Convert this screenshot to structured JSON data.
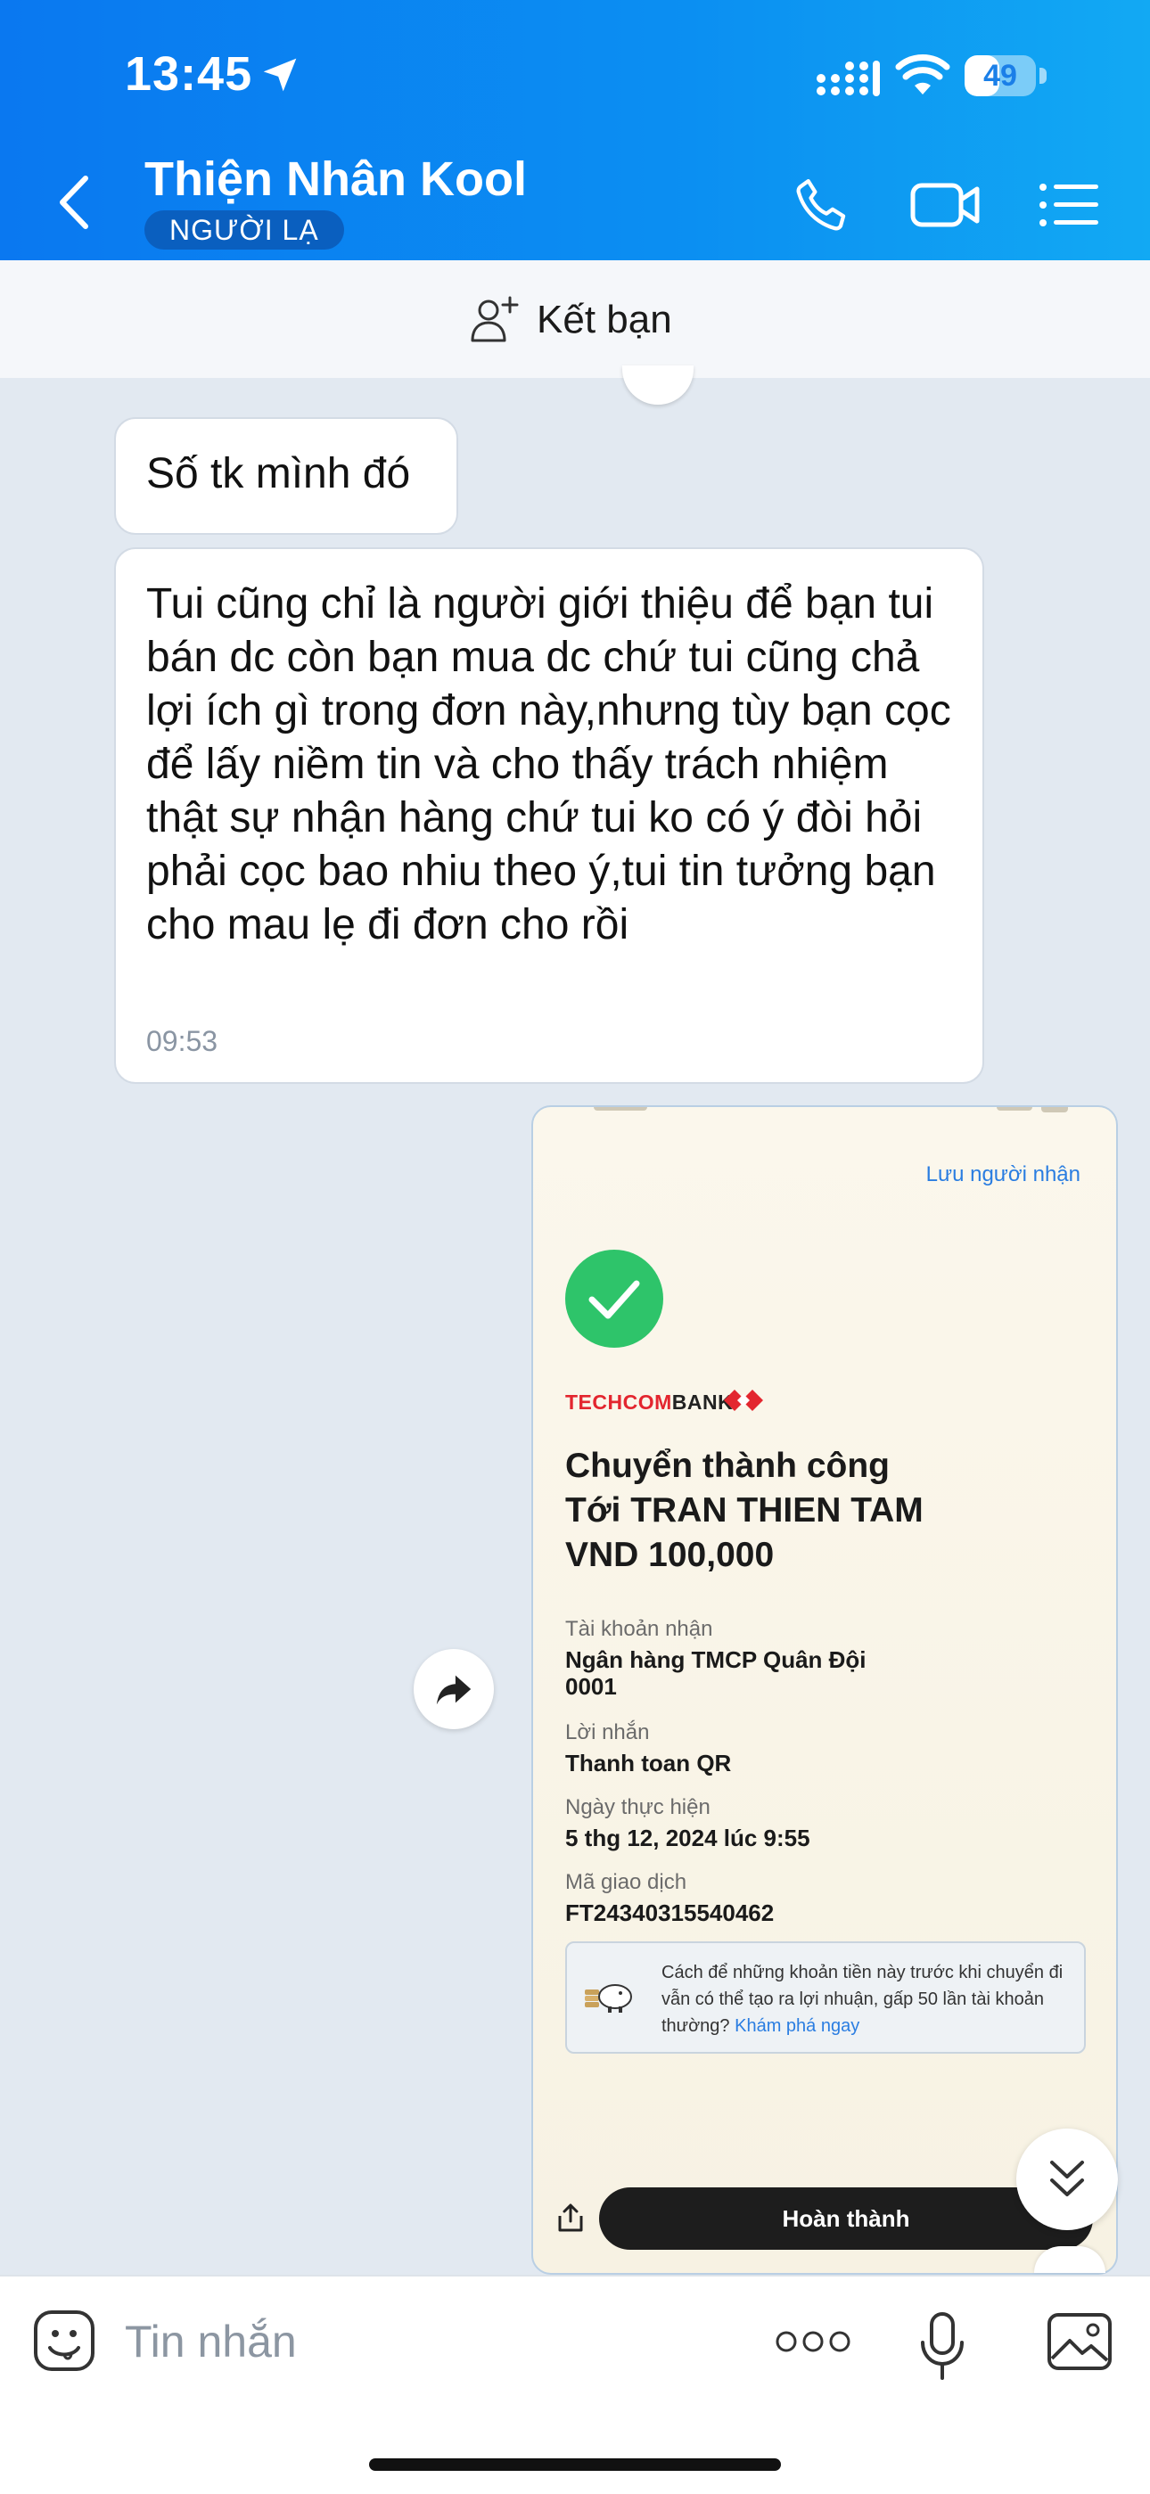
{
  "status_bar": {
    "time": "13:45",
    "battery": "49",
    "battery_level": 0.49
  },
  "header": {
    "contact_name": "Thiện Nhân Kool",
    "badge": "NGƯỜI LẠ"
  },
  "add_friend": {
    "label": "Kết bạn"
  },
  "messages": [
    {
      "text": "Số tk mình đó"
    },
    {
      "text": "Tui cũng chỉ là người giới thiệu để bạn tui bán dc còn bạn mua dc chứ tui cũng chả lợi ích gì trong đơn này,nhưng tùy bạn cọc để lấy niềm tin và cho thấy trách nhiệm thật sự nhận hàng chứ tui ko có ý đòi hỏi phải cọc bao nhiu theo ý,tui tin tưởng bạn cho mau lẹ đi đơn cho rồi",
      "time": "09:53"
    }
  ],
  "receipt": {
    "save_recipient": "Lưu người nhận",
    "bank_logo_red": "TECHCOM",
    "bank_logo_dark": "BANK",
    "title_line1": "Chuyển thành công",
    "title_line2": "Tới TRAN THIEN TAM",
    "title_line3": "VND 100,000",
    "account_label": "Tài khoản nhận",
    "account_bank": "Ngân hàng TMCP Quân Đội",
    "account_number": "0001",
    "message_label": "Lời nhắn",
    "message_value": "Thanh toan QR",
    "date_label": "Ngày thực hiện",
    "date_value": "5 thg 12, 2024 lúc 9:55",
    "txn_label": "Mã giao dịch",
    "txn_value": "FT24340315540462",
    "promo_text": "Cách để những khoản tiền này trước khi chuyển đi vẫn có thể tạo ra lợi nhuận, gấp 50 lần tài khoản thường?",
    "promo_link": "Khám phá ngay",
    "done_button": "Hoàn thành"
  },
  "input": {
    "placeholder": "Tin nhắn"
  },
  "colors": {
    "header_start": "#0a78f0",
    "header_end": "#12a9f3",
    "badge_bg": "#0a5fbf",
    "success_green": "#2ec46a",
    "techcom_red": "#e3262f"
  }
}
